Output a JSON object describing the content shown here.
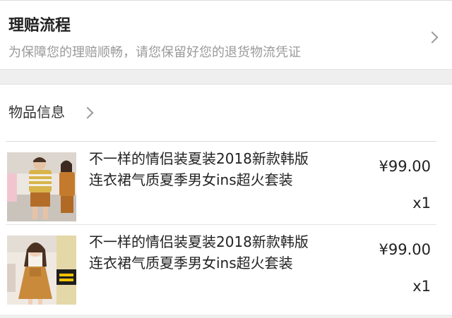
{
  "claim_process": {
    "title": "理赔流程",
    "subtitle": "为保障您的理赔顺畅，请您保留好您的退货物流凭证",
    "icon": "chevron-right-icon"
  },
  "goods": {
    "header_label": "物品信息",
    "header_icon": "chevron-right-icon",
    "items": [
      {
        "title": "不一样的情侣装夏装2018新款韩版连衣裙气质夏季男女ins超火套装",
        "price": "¥99.00",
        "quantity": "x1"
      },
      {
        "title": "不一样的情侣装夏装2018新款韩版连衣裙气质夏季男女ins超火套装",
        "price": "¥99.00",
        "quantity": "x1"
      }
    ]
  }
}
